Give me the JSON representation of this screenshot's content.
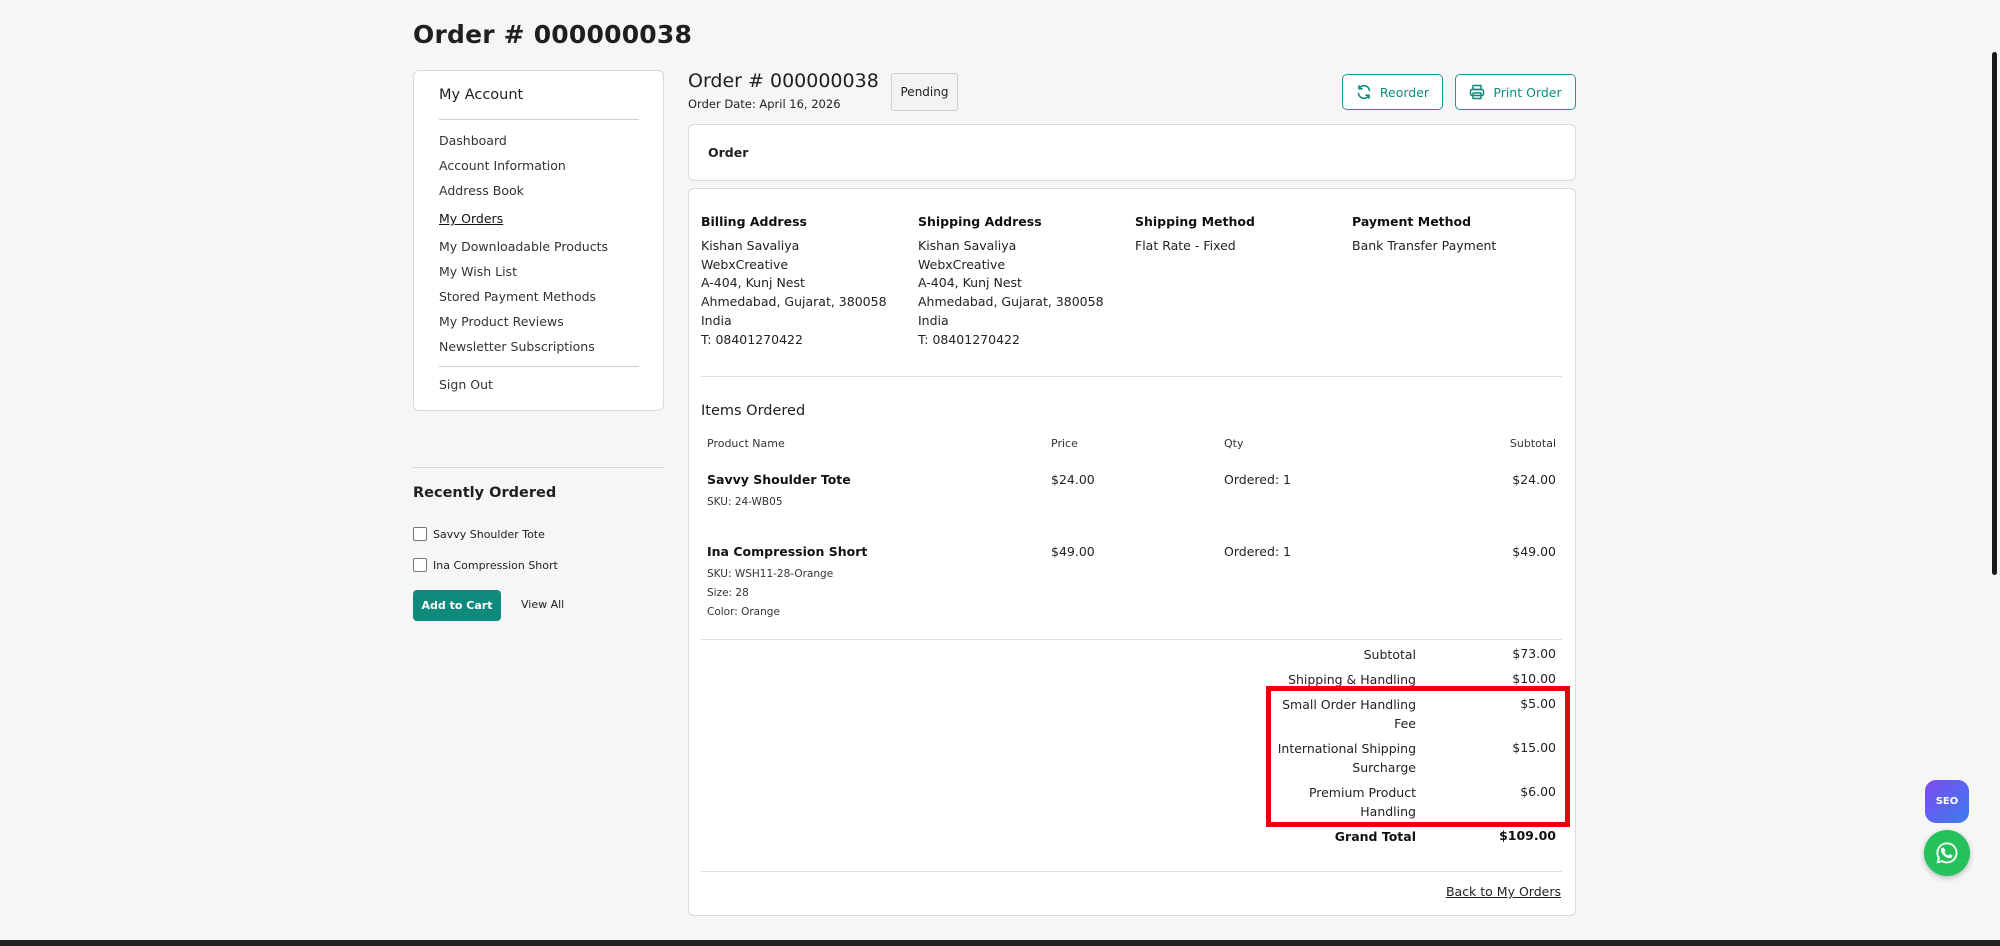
{
  "page_title": "Order # 000000038",
  "sidebar": {
    "title": "My Account",
    "links": [
      {
        "label": "Dashboard",
        "active": false
      },
      {
        "label": "Account Information",
        "active": false
      },
      {
        "label": "Address Book",
        "active": false
      },
      {
        "label": "My Orders",
        "active": true
      },
      {
        "label": "My Downloadable Products",
        "active": false
      },
      {
        "label": "My Wish List",
        "active": false
      },
      {
        "label": "Stored Payment Methods",
        "active": false
      },
      {
        "label": "My Product Reviews",
        "active": false
      },
      {
        "label": "Newsletter Subscriptions",
        "active": false
      }
    ],
    "sign_out": "Sign Out"
  },
  "recently_ordered": {
    "title": "Recently Ordered",
    "items": [
      "Savvy Shoulder Tote",
      "Ina Compression Short"
    ],
    "add_to_cart": "Add to Cart",
    "view_all": "View All"
  },
  "order": {
    "heading": "Order # 000000038",
    "date": "Order Date: April 16, 2026",
    "status": "Pending",
    "reorder_label": "Reorder",
    "print_label": "Print Order",
    "tab_label": "Order"
  },
  "info": {
    "billing": {
      "title": "Billing Address",
      "lines": [
        "Kishan Savaliya",
        "WebxCreative",
        "A-404, Kunj Nest",
        "Ahmedabad, Gujarat, 380058",
        "India",
        "T: 08401270422"
      ]
    },
    "shipping": {
      "title": "Shipping Address",
      "lines": [
        "Kishan Savaliya",
        "WebxCreative",
        "A-404, Kunj Nest",
        "Ahmedabad, Gujarat, 380058",
        "India",
        "T: 08401270422"
      ]
    },
    "shipping_method": {
      "title": "Shipping Method",
      "lines": [
        "Flat Rate - Fixed"
      ]
    },
    "payment_method": {
      "title": "Payment Method",
      "lines": [
        "Bank Transfer Payment"
      ]
    }
  },
  "items": {
    "title": "Items Ordered",
    "columns": {
      "product": "Product Name",
      "price": "Price",
      "qty": "Qty",
      "subtotal": "Subtotal"
    },
    "rows": [
      {
        "name": "Savvy Shoulder Tote",
        "details": [
          "SKU: 24-WB05"
        ],
        "price": "$24.00",
        "qty": "Ordered: 1",
        "subtotal": "$24.00"
      },
      {
        "name": "Ina Compression Short",
        "details": [
          "SKU: WSH11-28-Orange",
          "Size: 28",
          "Color: Orange"
        ],
        "price": "$49.00",
        "qty": "Ordered: 1",
        "subtotal": "$49.00"
      }
    ]
  },
  "totals": {
    "subtotal": {
      "label": "Subtotal",
      "value": "$73.00"
    },
    "shipping": {
      "label": "Shipping & Handling",
      "value": "$10.00"
    },
    "small_order": {
      "label_1": "Small Order Handling",
      "label_2": "Fee",
      "value": "$5.00"
    },
    "intl_shipping": {
      "label_1": "International Shipping",
      "label_2": "Surcharge",
      "value": "$15.00"
    },
    "premium": {
      "label_1": "Premium Product",
      "label_2": "Handling",
      "value": "$6.00"
    },
    "grand_total": {
      "label": "Grand Total",
      "value": "$109.00"
    }
  },
  "back_link": "Back to My Orders",
  "widgets": {
    "seo": "SEO"
  },
  "colors": {
    "accent": "#0f8a7d",
    "highlight": "#e8000b",
    "whatsapp": "#25c25b"
  }
}
